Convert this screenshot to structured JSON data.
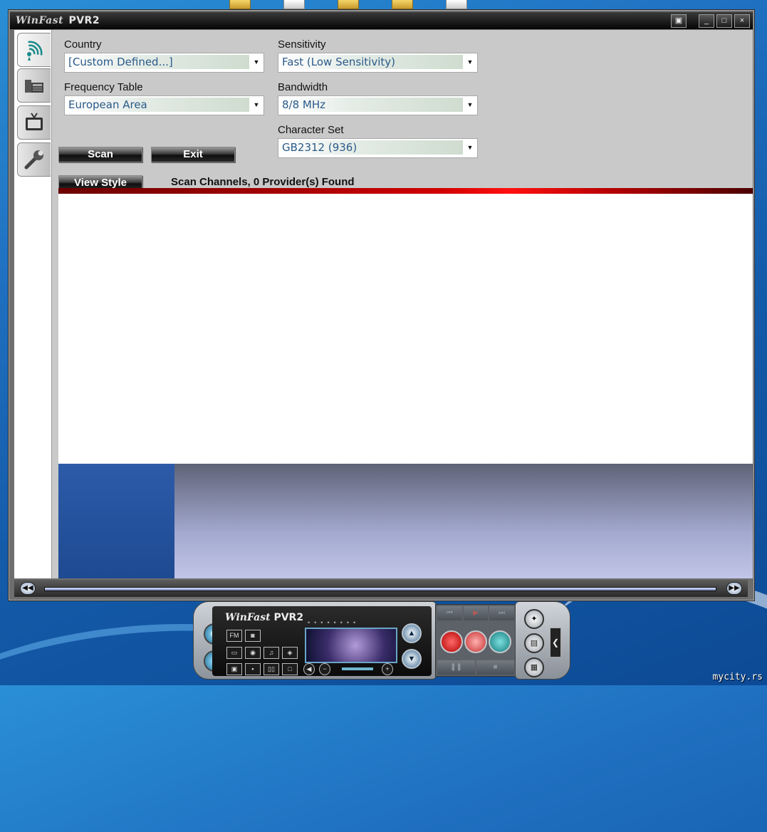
{
  "window": {
    "title_brand": "WinFast",
    "title_product": "PVR2",
    "buttons": [
      "▣",
      "_",
      "□",
      "×"
    ]
  },
  "sidebar": {
    "tabs": [
      {
        "name": "antenna-scan",
        "active": true
      },
      {
        "name": "channel-list",
        "active": false
      },
      {
        "name": "tv",
        "active": false
      },
      {
        "name": "settings",
        "active": false
      }
    ]
  },
  "scan": {
    "country_label": "Country",
    "country_value": "[Custom Defined...]",
    "frequency_label": "Frequency Table",
    "frequency_value": "European Area",
    "sensitivity_label": "Sensitivity",
    "sensitivity_value": "Fast (Low Sensitivity)",
    "bandwidth_label": "Bandwidth",
    "bandwidth_value": "8/8 MHz",
    "charset_label": "Character Set",
    "charset_value": "GB2312 (936)",
    "scan_button": "Scan",
    "exit_button": "Exit",
    "view_style_button": "View Style",
    "status": "Scan Channels, 0 Provider(s) Found"
  },
  "player": {
    "brand": "WinFast",
    "product": "PVR2",
    "fm_label": "FM"
  },
  "desktop": {
    "watermark": "mycity.rs"
  },
  "colors": {
    "accent_red": "#d00000",
    "combo_text": "#2a5a8a",
    "preview_blue": "#1e4a92"
  }
}
